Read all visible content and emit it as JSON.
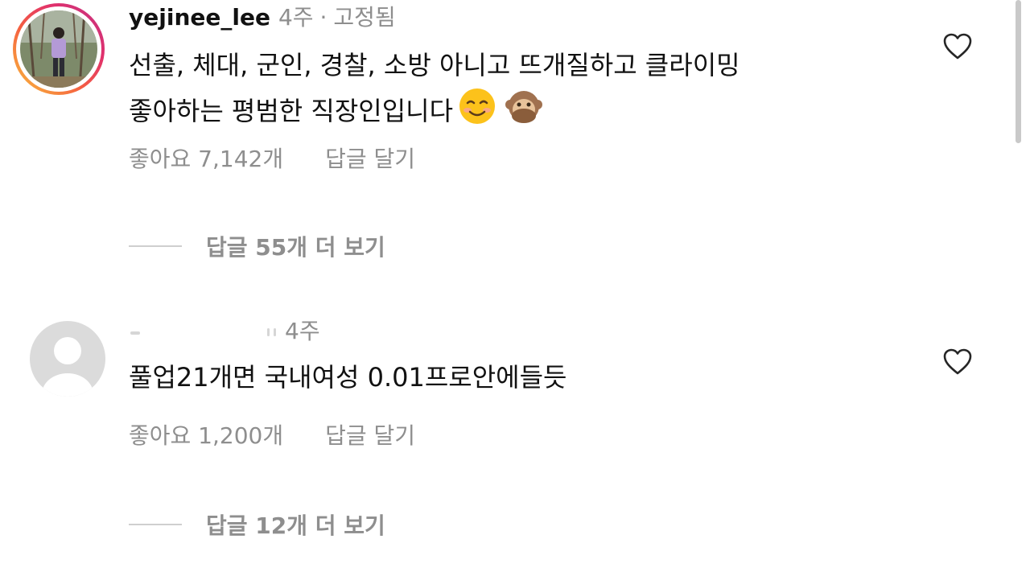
{
  "comments": [
    {
      "username": "yejinee_lee",
      "time": "4주",
      "pinned_label": "고정됨",
      "text_line1": "선출, 체대, 군인, 경찰, 소방 아니고 뜨개질하고 클라이밍",
      "text_line2": "좋아하는 평범한 직장인입니다",
      "emojis": [
        "smiling-face-icon",
        "see-no-evil-monkey-icon"
      ],
      "likes": "좋아요 7,142개",
      "reply_label": "답글 달기",
      "more_replies": "답글 55개 더 보기"
    },
    {
      "username": "",
      "time": "4주",
      "text_line1": "풀업21개면 국내여성  0.01프로안에들듯",
      "likes": "좋아요 1,200개",
      "reply_label": "답글 달기",
      "more_replies": "답글 12개 더 보기"
    }
  ],
  "colors": {
    "text": "#111111",
    "muted": "#8e8e8e",
    "ring_start": "#f9c23c",
    "ring_end": "#c13584"
  }
}
